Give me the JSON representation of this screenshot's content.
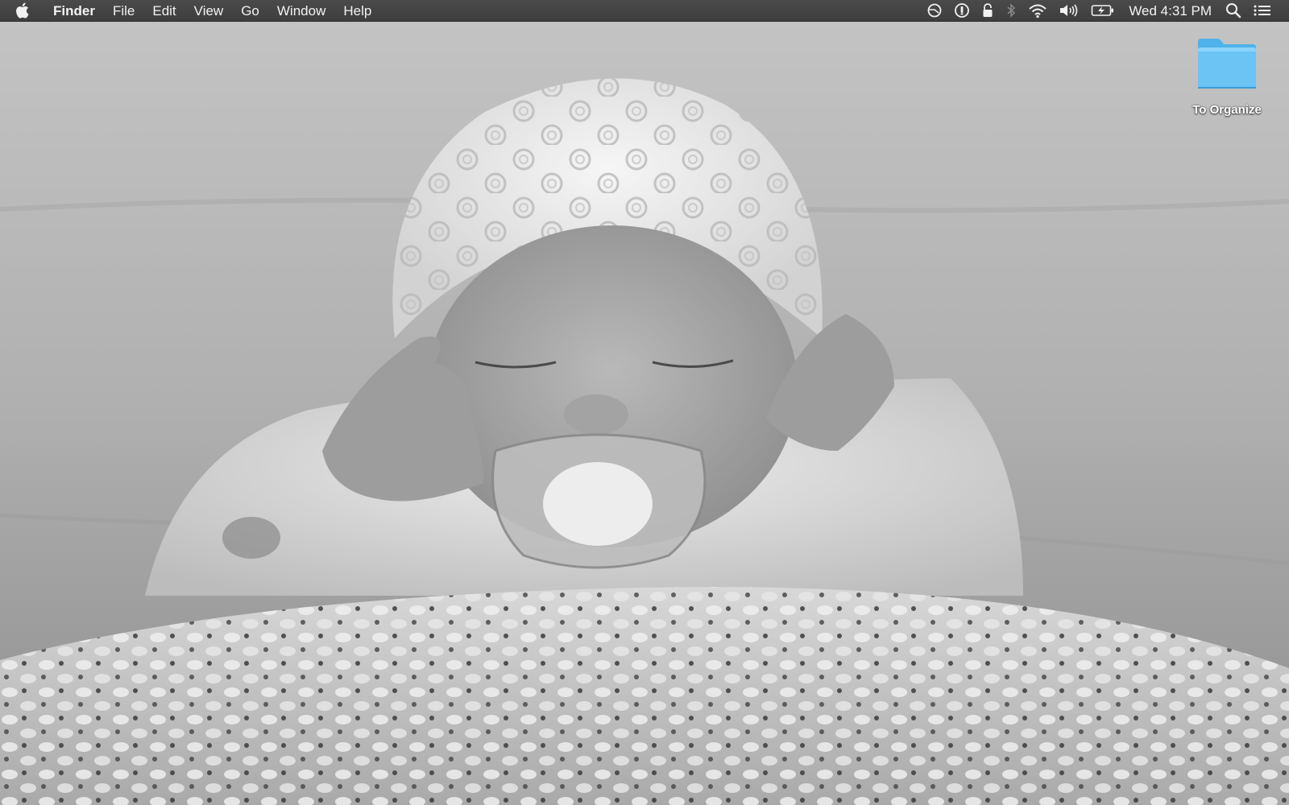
{
  "menubar": {
    "apple_icon": "apple-logo-icon",
    "app_name": "Finder",
    "menus": [
      "File",
      "Edit",
      "View",
      "Go",
      "Window",
      "Help"
    ],
    "status_icons": [
      "time-machine-icon",
      "password-manager-icon",
      "lock-icon",
      "bluetooth-icon",
      "wifi-icon",
      "volume-icon",
      "battery-charging-icon"
    ],
    "clock": "Wed 4:31 PM",
    "right_icons": [
      "spotlight-search-icon",
      "notification-center-icon"
    ]
  },
  "desktop": {
    "wallpaper_style": "grayscale photo",
    "icons": [
      {
        "label": "To Organize",
        "type": "folder",
        "color": "#6cc4f5"
      }
    ]
  },
  "colors": {
    "menubar_bg": "#444444",
    "menubar_text": "#f2f2f2",
    "folder_blue": "#6cc4f5"
  }
}
